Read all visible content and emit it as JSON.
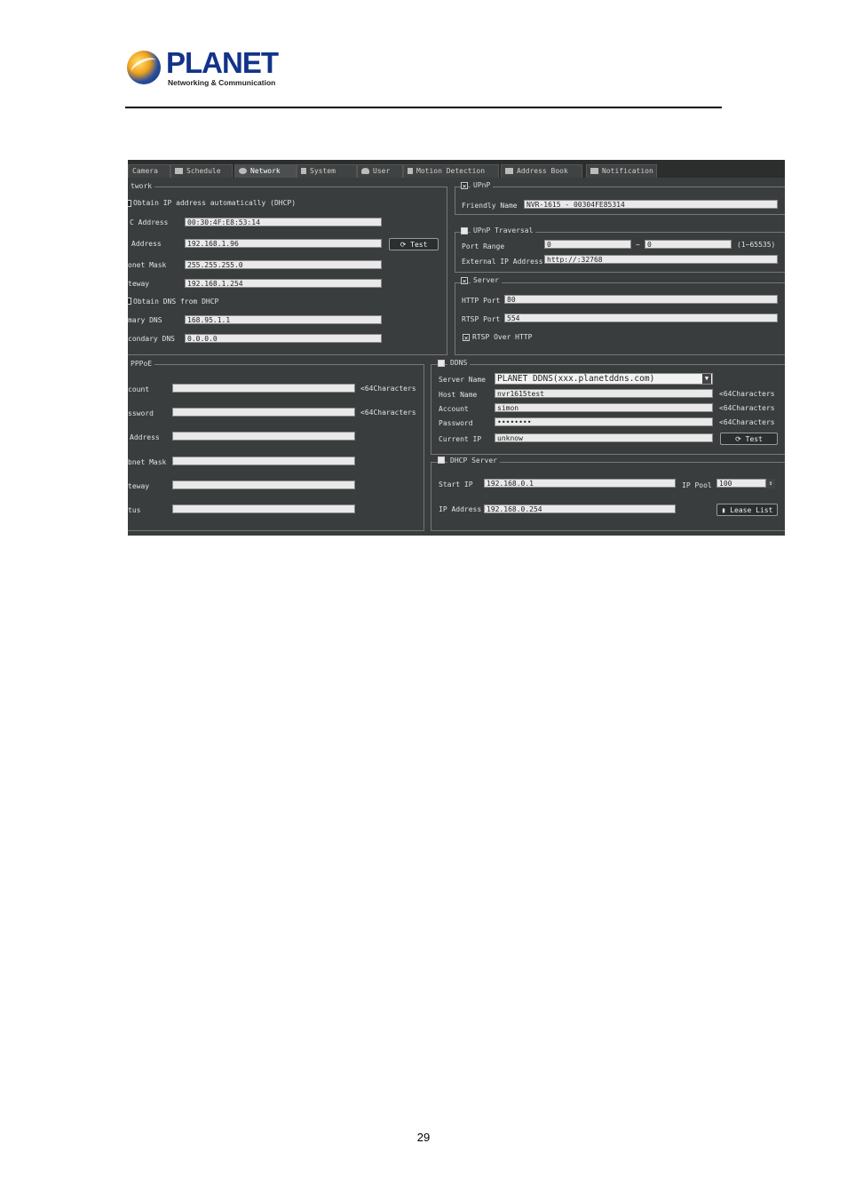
{
  "logo": {
    "brand": "PLANET",
    "tagline": "Networking & Communication"
  },
  "tabs": [
    "Camera",
    "Schedule",
    "Network",
    "System",
    "User",
    "Motion Detection",
    "Address Book",
    "Notification"
  ],
  "network": {
    "group": "twork",
    "dhcp": "Obtain IP address automatically (DHCP)",
    "mac_label": "C Address",
    "mac": "00:30:4F:E8:53:14",
    "ip_label": "Address",
    "ip": "192.168.1.96",
    "mask_label": "onet Mask",
    "mask": "255.255.255.0",
    "gw_label": "teway",
    "gw": "192.168.1.254",
    "dns_dhcp": "Obtain DNS from DHCP",
    "pdns_label": "mary DNS",
    "pdns": "168.95.1.1",
    "sdns_label": "condary DNS",
    "sdns": "0.0.0.0",
    "test": "Test"
  },
  "upnp": {
    "group": "UPnP",
    "name_label": "Friendly Name",
    "name": "NVR-1615 - 00304FE85314"
  },
  "traversal": {
    "group": "UPnP Traversal",
    "range_label": "Port Range",
    "from": "0",
    "dash": "~",
    "to": "0",
    "range_hint": "(1~65535)",
    "ext_label": "External IP Address",
    "ext": "http://:32768"
  },
  "server": {
    "group": "Server",
    "http_label": "HTTP Port",
    "http": "80",
    "rtsp_label": "RTSP Port",
    "rtsp": "554",
    "over": "RTSP Over HTTP"
  },
  "pppoe": {
    "group": "PPPoE",
    "acc_label": "count",
    "pwd_label": "ssword",
    "addr_label": "Address",
    "mask_label": "bnet Mask",
    "gw_label": "teway",
    "status_label": "tus",
    "hint": "<64Characters"
  },
  "ddns": {
    "group": "DDNS",
    "srv_label": "Server Name",
    "srv": "PLANET DDNS(xxx.planetddns.com)",
    "host_label": "Host Name",
    "host": "nvr1615test",
    "acc_label": "Account",
    "acc": "simon",
    "pwd_label": "Password",
    "pwd": "••••••••",
    "cur_label": "Current IP",
    "cur": "unknow",
    "hint": "<64Characters",
    "test": "Test"
  },
  "dhcp": {
    "group": "DHCP Server",
    "start_label": "Start IP",
    "start": "192.168.0.1",
    "pool_label": "IP Pool",
    "pool": "100",
    "ip_label": "IP Address",
    "ip": "192.168.0.254",
    "lease": "Lease List"
  },
  "page_number": "29"
}
